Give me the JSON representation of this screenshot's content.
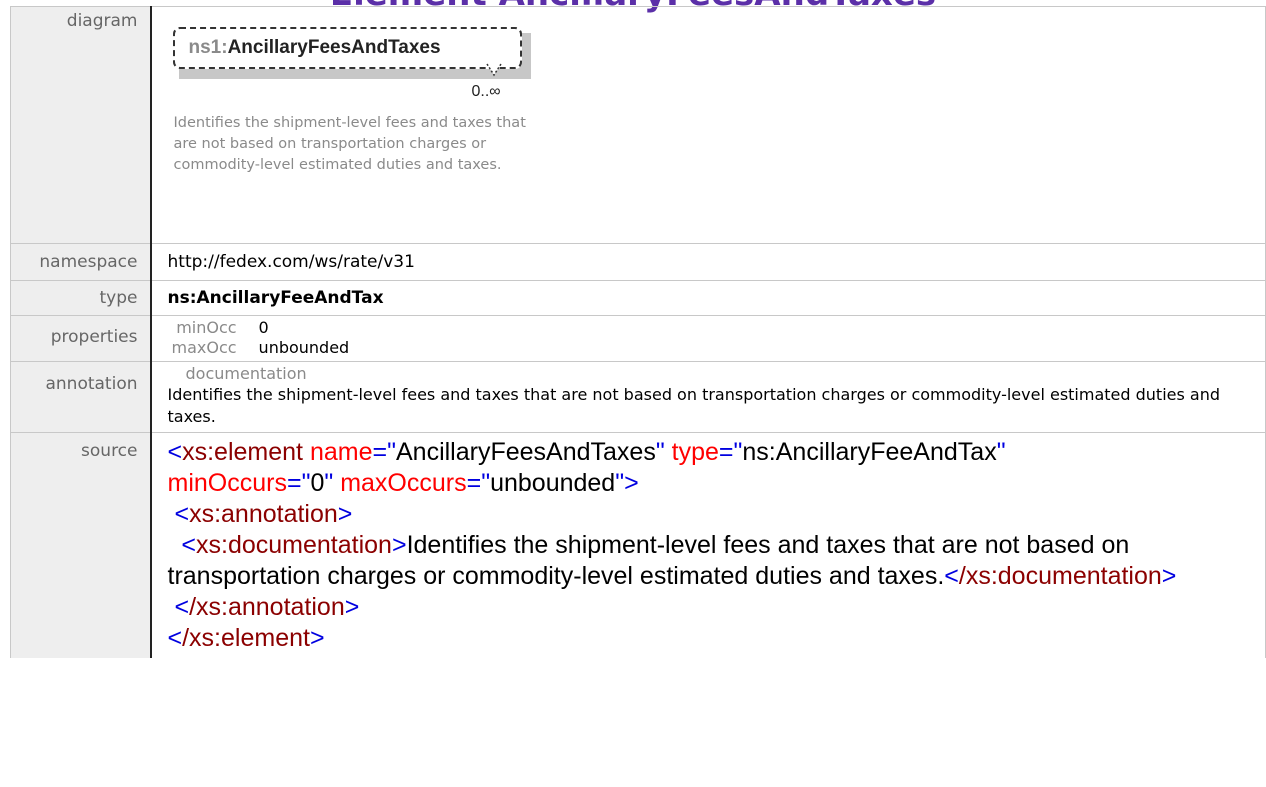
{
  "heading": "Element AncillaryFeesAndTaxes",
  "rows": {
    "diagram": {
      "label": "diagram",
      "prefix": "ns1:",
      "name": "AncillaryFeesAndTaxes",
      "occurs": "0..∞",
      "doc": "Identifies the shipment-level fees and taxes that are not based on transportation charges or commodity-level estimated duties and taxes."
    },
    "namespace": {
      "label": "namespace",
      "value": "http://fedex.com/ws/rate/v31"
    },
    "type": {
      "label": "type",
      "value": "ns:AncillaryFeeAndTax"
    },
    "properties": {
      "label": "properties",
      "items": [
        {
          "key": "minOcc",
          "value": "0"
        },
        {
          "key": "maxOcc",
          "value": "unbounded"
        }
      ]
    },
    "annotation": {
      "label": "annotation",
      "title": "documentation",
      "text": "Identifies the shipment-level fees and taxes that are not based on transportation charges or commodity-level estimated duties and taxes."
    },
    "source": {
      "label": "source",
      "open_tag": "xs:element",
      "attr_name": "name",
      "attr_name_val": "AncillaryFeesAndTaxes",
      "attr_type": "type",
      "attr_type_val": "ns:AncillaryFeeAndTax",
      "attr_min": "minOccurs",
      "attr_min_val": "0",
      "attr_max": "maxOccurs",
      "attr_max_val": "unbounded",
      "annotation_tag": "xs:annotation",
      "documentation_tag": "xs:documentation",
      "documentation_text": "Identifies the shipment-level fees and taxes that are not based on transportation charges or commodity-level estimated duties and taxes.",
      "close_documentation": "/xs:documentation",
      "close_annotation": "/xs:annotation",
      "close_element": "/xs:element"
    }
  }
}
